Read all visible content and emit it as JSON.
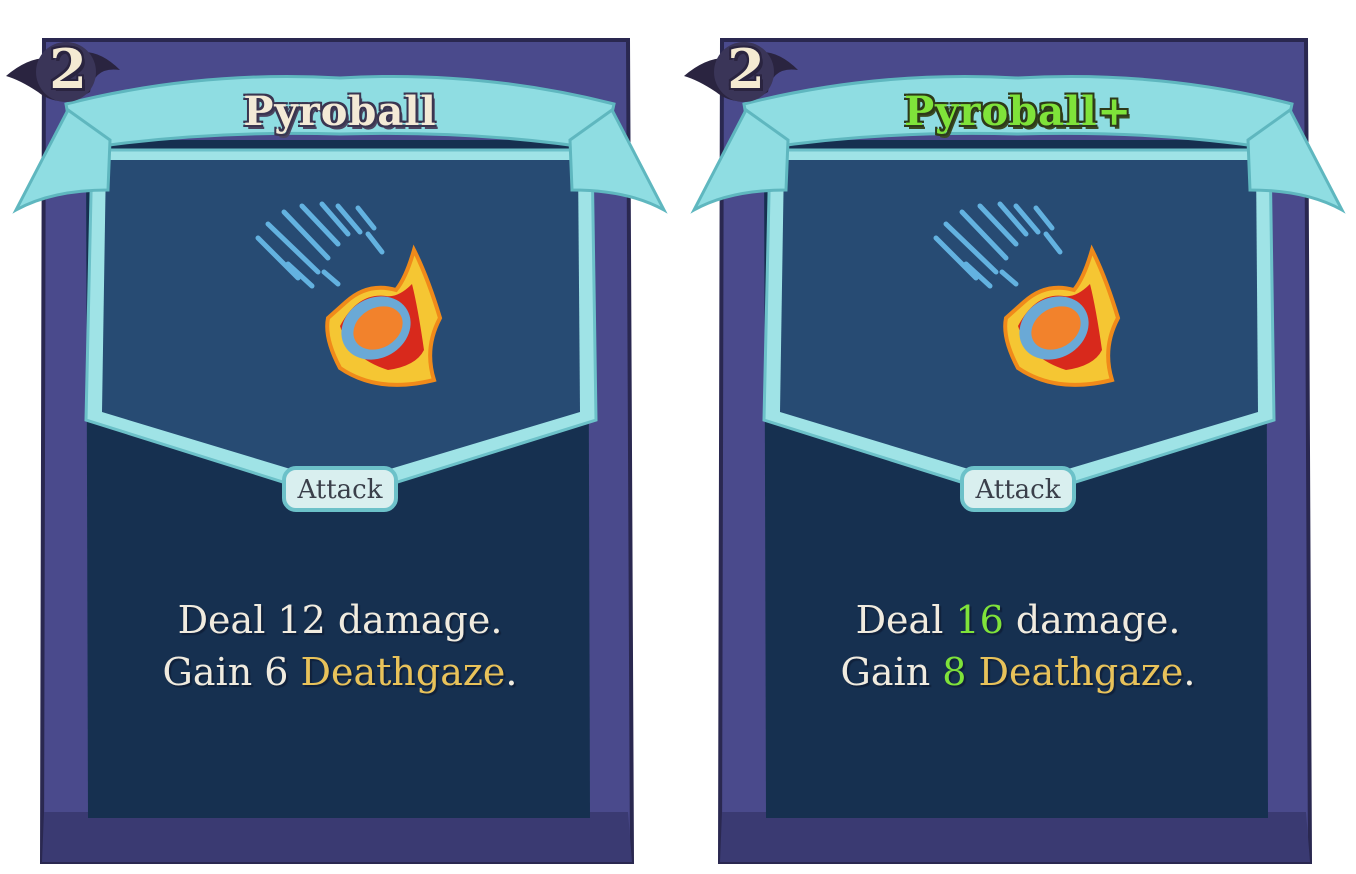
{
  "cards": [
    {
      "cost": "2",
      "name": "Pyroball",
      "type": "Attack",
      "desc_line1": {
        "pre": "Deal ",
        "value": "12",
        "post": " damage."
      },
      "desc_line2": {
        "pre": "Gain ",
        "value": "6",
        "keyword": "Deathgaze",
        "post": "."
      },
      "upgraded": false
    },
    {
      "cost": "2",
      "name": "Pyroball+",
      "type": "Attack",
      "desc_line1": {
        "pre": "Deal ",
        "value": "16",
        "post": " damage."
      },
      "desc_line2": {
        "pre": "Gain ",
        "value": "8",
        "keyword": "Deathgaze",
        "post": "."
      },
      "upgraded": true
    }
  ],
  "colors": {
    "frame_purple": "#4a4a8c",
    "frame_dark": "#2e2c5e",
    "banner_cyan": "#8fdde2",
    "art_bg": "#274b73",
    "body_bg": "#163050",
    "keyword_gold": "#e8c25a",
    "upgrade_green": "#7fe33a"
  },
  "icons": [
    "fireball-art-icon",
    "cost-orb-icon"
  ]
}
